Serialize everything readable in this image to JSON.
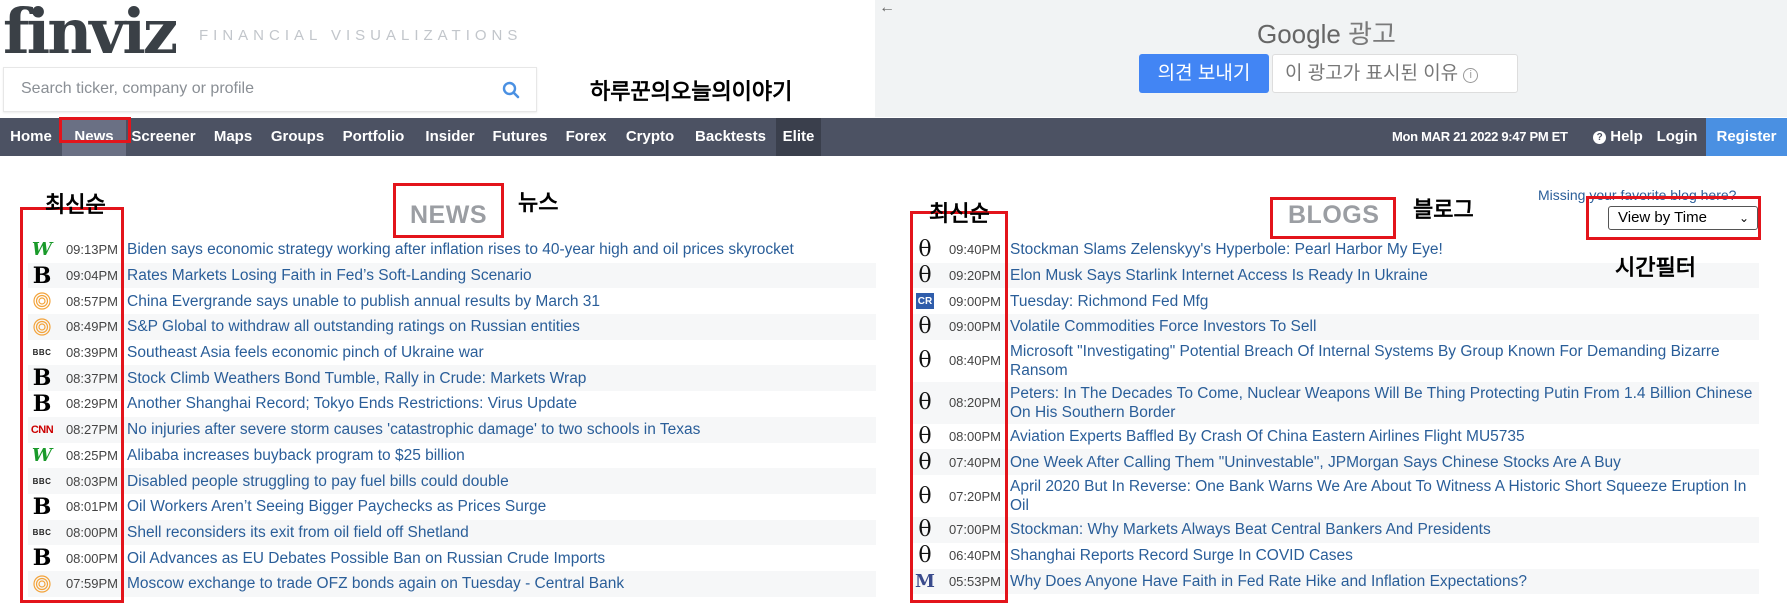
{
  "header": {
    "logo": "finviz",
    "tagline": "FINANCIAL VISUALIZATIONS",
    "search_placeholder": "Search ticker, company or profile",
    "annotation": "하루꾼의오늘의이야기"
  },
  "ad": {
    "back_glyph": "←",
    "google": "Google",
    "ad_label": "광고",
    "send_feedback": "의견 보내기",
    "why_this_ad": "이 광고가 표시된 이유",
    "info_glyph": "i"
  },
  "nav": {
    "items": [
      "Home",
      "News",
      "Screener",
      "Maps",
      "Groups",
      "Portfolio",
      "Insider",
      "Futures",
      "Forex",
      "Crypto",
      "Backtests",
      "Elite"
    ],
    "date": "Mon MAR 21 2022 9:47 PM ET",
    "help_glyph": "?",
    "help": "Help",
    "login": "Login",
    "register": "Register"
  },
  "annotations": {
    "newest_left": "최신순",
    "news_kr": "뉴스",
    "newest_right": "최신순",
    "blog_kr": "블로그",
    "time_filter": "시간필터"
  },
  "news": {
    "section_title": "NEWS",
    "items": [
      {
        "source": "wsj",
        "glyph": "W",
        "time": "09:13PM",
        "title": "Biden says economic strategy working after inflation rises to 40-year high and oil prices skyrocket"
      },
      {
        "source": "bloomberg",
        "glyph": "B",
        "time": "09:04PM",
        "title": "Rates Markets Losing Faith in Fed’s Soft-Landing Scenario"
      },
      {
        "source": "yahoo",
        "glyph": "",
        "time": "08:57PM",
        "title": "China Evergrande says unable to publish annual results by March 31"
      },
      {
        "source": "yahoo",
        "glyph": "",
        "time": "08:49PM",
        "title": "S&P Global to withdraw all outstanding ratings on Russian entities"
      },
      {
        "source": "bbc",
        "glyph": "BBC",
        "time": "08:39PM",
        "title": "Southeast Asia feels economic pinch of Ukraine war"
      },
      {
        "source": "bloomberg",
        "glyph": "B",
        "time": "08:37PM",
        "title": "Stock Climb Weathers Bond Tumble, Rally in Crude: Markets Wrap"
      },
      {
        "source": "bloomberg",
        "glyph": "B",
        "time": "08:29PM",
        "title": "Another Shanghai Record; Tokyo Ends Restrictions: Virus Update"
      },
      {
        "source": "cnn",
        "glyph": "CNN",
        "time": "08:27PM",
        "title": "No injuries after severe storm causes 'catastrophic damage' to two schools in Texas"
      },
      {
        "source": "wsj",
        "glyph": "W",
        "time": "08:25PM",
        "title": "Alibaba increases buyback program to $25 billion"
      },
      {
        "source": "bbc",
        "glyph": "BBC",
        "time": "08:03PM",
        "title": "Disabled people struggling to pay fuel bills could double"
      },
      {
        "source": "bloomberg",
        "glyph": "B",
        "time": "08:01PM",
        "title": "Oil Workers Aren’t Seeing Bigger Paychecks as Prices Surge"
      },
      {
        "source": "bbc",
        "glyph": "BBC",
        "time": "08:00PM",
        "title": "Shell reconsiders its exit from oil field off Shetland"
      },
      {
        "source": "bloomberg",
        "glyph": "B",
        "time": "08:00PM",
        "title": "Oil Advances as EU Debates Possible Ban on Russian Crude Imports"
      },
      {
        "source": "yahoo",
        "glyph": "",
        "time": "07:59PM",
        "title": "Moscow exchange to trade OFZ bonds again on Tuesday - Central Bank"
      }
    ]
  },
  "blogs": {
    "section_title": "BLOGS",
    "missing_blog": "Missing your favorite blog here?",
    "filter_value": "View by Time",
    "filter_chevron": "⌄",
    "items": [
      {
        "source": "zerohedge",
        "glyph": "θ",
        "time": "09:40PM",
        "title": "Stockman Slams Zelenskyy's Hyperbole: Pearl Harbor My Eye!"
      },
      {
        "source": "zerohedge",
        "glyph": "θ",
        "time": "09:20PM",
        "title": "Elon Musk Says Starlink Internet Access Is Ready In Ukraine"
      },
      {
        "source": "calculated-risk",
        "glyph": "CR",
        "time": "09:00PM",
        "title": "Tuesday: Richmond Fed Mfg"
      },
      {
        "source": "zerohedge",
        "glyph": "θ",
        "time": "09:00PM",
        "title": "Volatile Commodities Force Investors To Sell"
      },
      {
        "source": "zerohedge",
        "glyph": "θ",
        "time": "08:40PM",
        "title": "Microsoft \"Investigating\" Potential Breach Of Internal Systems By Group Known For Demanding Bizarre Ransom"
      },
      {
        "source": "zerohedge",
        "glyph": "θ",
        "time": "08:20PM",
        "title": "Peters: In The Decades To Come, Nuclear Weapons Will Be Thing Protecting Putin From 1.4 Billion Chinese On His Southern Border"
      },
      {
        "source": "zerohedge",
        "glyph": "θ",
        "time": "08:00PM",
        "title": "Aviation Experts Baffled By Crash Of China Eastern Airlines Flight MU5735"
      },
      {
        "source": "zerohedge",
        "glyph": "θ",
        "time": "07:40PM",
        "title": "One Week After Calling Them \"Uninvestable\", JPMorgan Says Chinese Stocks Are A Buy"
      },
      {
        "source": "zerohedge",
        "glyph": "θ",
        "time": "07:20PM",
        "title": "April 2020 But In Reverse: One Bank Warns We Are About To Witness A Historic Short Squeeze Eruption In Oil"
      },
      {
        "source": "zerohedge",
        "glyph": "θ",
        "time": "07:00PM",
        "title": "Stockman: Why Markets Always Beat Central Bankers And Presidents"
      },
      {
        "source": "zerohedge",
        "glyph": "θ",
        "time": "06:40PM",
        "title": "Shanghai Reports Record Surge In COVID Cases"
      },
      {
        "source": "mish",
        "glyph": "M",
        "time": "05:53PM",
        "title": "Why Does Anyone Have Faith in Fed Rate Hike and Inflation Expectations?"
      }
    ]
  }
}
